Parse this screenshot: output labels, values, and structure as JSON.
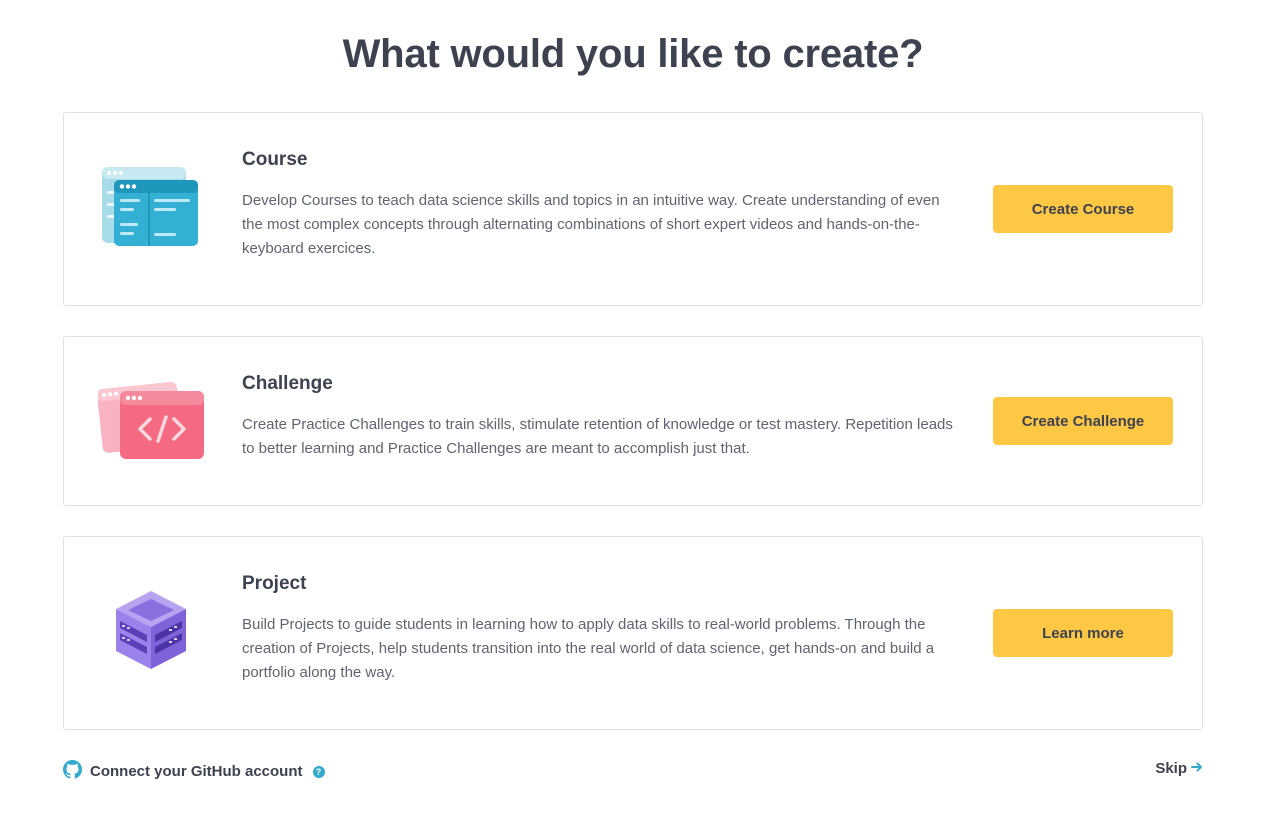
{
  "page": {
    "title": "What would you like to create?"
  },
  "cards": {
    "course": {
      "title": "Course",
      "description": "Develop Courses to teach data science skills and topics in an intuitive way. Create understanding of even the most complex concepts through alternating combinations of short expert videos and hands-on-the-keyboard exercices.",
      "button_label": "Create Course",
      "icon": "course-windows-icon"
    },
    "challenge": {
      "title": "Challenge",
      "description": "Create Practice Challenges to train skills, stimulate retention of knowledge or test mastery. Repetition leads to better learning and Practice Challenges are meant to accomplish just that.",
      "button_label": "Create Challenge",
      "icon": "code-window-icon"
    },
    "project": {
      "title": "Project",
      "description": "Build Projects to guide students in learning how to apply data skills to real-world problems. Through the creation of Projects, help students transition into the real world of data science, get hands-on and build a portfolio along the way.",
      "button_label": "Learn more",
      "icon": "project-box-icon"
    }
  },
  "footer": {
    "github_label": "Connect your GitHub account",
    "help_glyph": "?",
    "skip_label": "Skip"
  },
  "colors": {
    "button": "#ffc844",
    "text": "#3d4251",
    "accent": "#33aacc",
    "border": "#dfe2e6"
  }
}
